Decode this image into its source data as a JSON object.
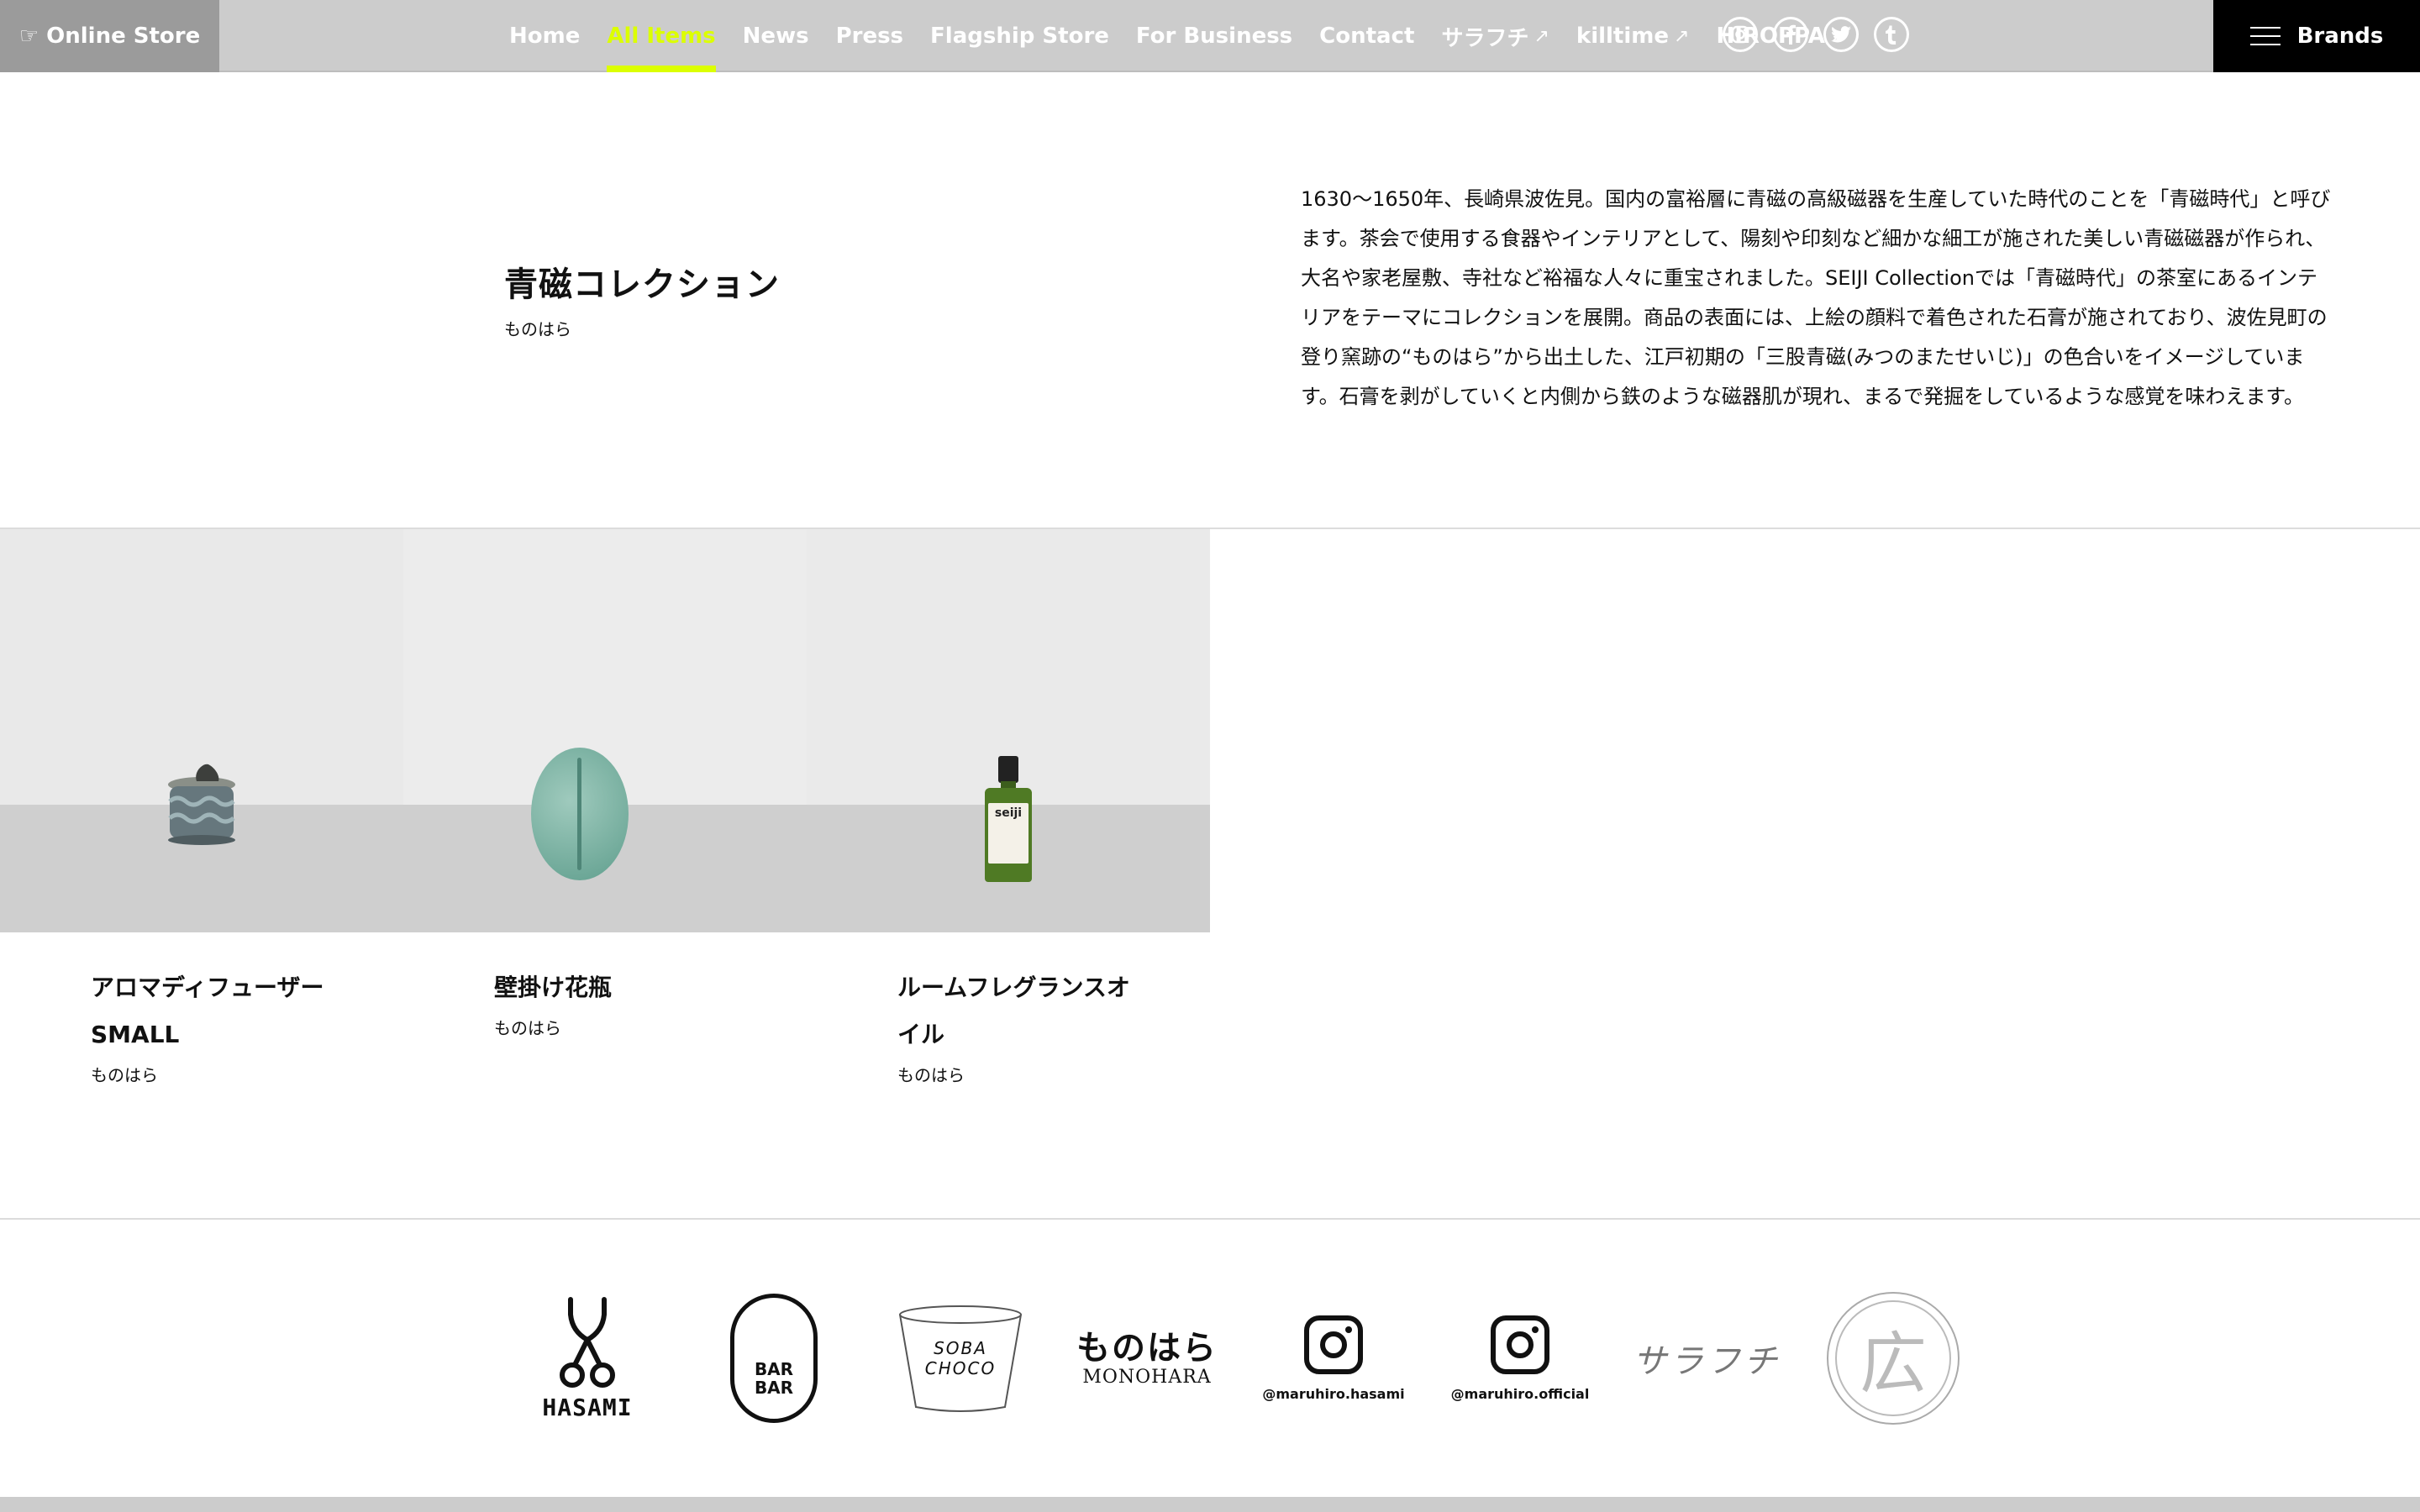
{
  "header": {
    "online_store": "☞ Online Store",
    "nav": [
      {
        "label": "Home",
        "external": false,
        "active": false
      },
      {
        "label": "All Items",
        "external": false,
        "active": true
      },
      {
        "label": "News",
        "external": false,
        "active": false
      },
      {
        "label": "Press",
        "external": false,
        "active": false
      },
      {
        "label": "Flagship Store",
        "external": false,
        "active": false
      },
      {
        "label": "For Business",
        "external": false,
        "active": false
      },
      {
        "label": "Contact",
        "external": false,
        "active": false
      },
      {
        "label": "サラフチ",
        "external": true,
        "active": false
      },
      {
        "label": "killtime",
        "external": true,
        "active": false
      },
      {
        "label": "HIROPPA",
        "external": true,
        "active": false
      }
    ],
    "external_arrow": "↗",
    "socials": [
      "instagram-icon",
      "facebook-icon",
      "twitter-icon",
      "tumblr-icon"
    ],
    "brands": "Brands",
    "accent_color": "#dcff00"
  },
  "intro": {
    "title": "青磁コレクション",
    "brand": "ものはら",
    "description": "1630〜1650年、長崎県波佐見。国内の富裕層に青磁の高級磁器を生産していた時代のことを「青磁時代」と呼びます。茶会で使用する食器やインテリアとして、陽刻や印刻など細かな細工が施された美しい青磁磁器が作られ、大名や家老屋敷、寺社など裕福な人々に重宝されました。SEIJI Collectionでは「青磁時代」の茶室にあるインテリアをテーマにコレクションを展開。商品の表面には、上絵の顔料で着色された石膏が施されており、波佐見町の登り窯跡の“ものはら”から出土した、江戸初期の「三股青磁(みつのまたせいじ)」の色合いをイメージしています。石膏を剥がしていくと内側から鉄のような磁器肌が現れ、まるで発掘をしているような感覚を味わえます。"
  },
  "products": [
    {
      "name": "アロマディフューザーSMALL",
      "brand": "ものはら"
    },
    {
      "name": "壁掛け花瓶",
      "brand": "ものはら"
    },
    {
      "name": "ルームフレグランスオイル",
      "brand": "ものはら",
      "bottle_label": "seiji"
    }
  ],
  "footer": {
    "logos": {
      "hasami": "HASAMI",
      "barbar": "BAR\nBAR",
      "soba": "SOBA\nCHOCO",
      "monohara_jp": "ものはら",
      "monohara_en": "MONOHARA",
      "ig1": "@maruhiro.hasami",
      "ig2": "@maruhiro.official",
      "sarafuchi": "サラフチ",
      "kou": "広"
    }
  }
}
